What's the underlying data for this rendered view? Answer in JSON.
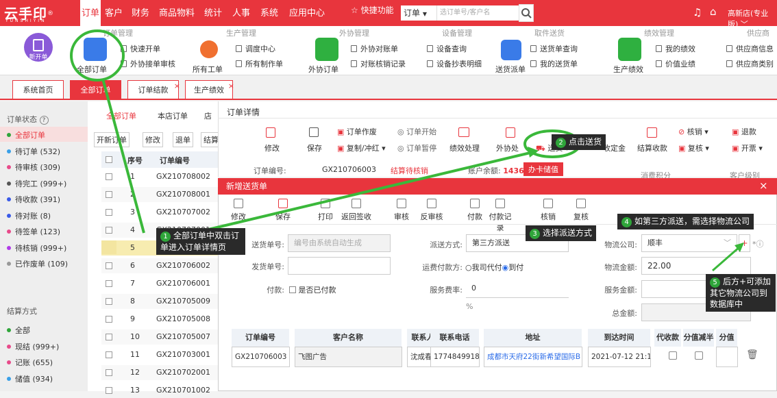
{
  "app": {
    "logo": "云手印",
    "logo_sub": "YUNSHIYIN",
    "logo_badge": "®"
  },
  "nav": {
    "items": [
      "订单",
      "客户",
      "财务",
      "商品物料",
      "统计",
      "人事",
      "系统",
      "应用中心"
    ],
    "quick": "快捷功能",
    "order_select": "订单",
    "search_placeholder": "选订单号/客户名",
    "shop": "高新店(专业版)"
  },
  "ribbon": {
    "groups": [
      "订单管理",
      "生产管理",
      "外协管理",
      "设备管理",
      "取件送货",
      "绩效管理",
      "供应商"
    ],
    "new_order": "新开单",
    "all_orders": "全部订单",
    "quick_order": "快速开单",
    "outsource_review": "外协接单审核",
    "all_work": "所有工单",
    "schedule": "调度中心",
    "all_production": "所有制作单",
    "outsource_order": "外协订单",
    "outsource_reconcile": "外协对账单",
    "reconcile_record": "对账核销记录",
    "device_query": "设备查询",
    "device_meter": "设备抄表明细",
    "dispatch": "送货派单",
    "delivery_query": "送货单查询",
    "my_delivery": "我的送货单",
    "perf": "生产绩效",
    "my_perf": "我的绩效",
    "value_perf": "价值业绩",
    "supplier_info": "供应商信息",
    "supplier_cat": "供应商类别"
  },
  "tabs": [
    "系统首页",
    "全部订单",
    "订单结款",
    "生产绩效"
  ],
  "left": {
    "title": "订单状态",
    "statuses": [
      {
        "label": "全部订单",
        "color": "#2fa53a"
      },
      {
        "label": "待订单 (532)",
        "color": "#3aa0e8"
      },
      {
        "label": "待审核 (309)",
        "color": "#e84a8a"
      },
      {
        "label": "待完工 (999+)",
        "color": "#555"
      },
      {
        "label": "待收款 (391)",
        "color": "#3a5ae8"
      },
      {
        "label": "待对账 (8)",
        "color": "#3a5ae8"
      },
      {
        "label": "待签单 (123)",
        "color": "#e84a8a"
      },
      {
        "label": "待核销 (999+)",
        "color": "#b03ae8"
      },
      {
        "label": "已作废单 (109)",
        "color": "#999"
      }
    ],
    "settle_title": "结算方式",
    "settles": [
      {
        "label": "全部",
        "color": "#2fa53a"
      },
      {
        "label": "现结 (999+)",
        "color": "#e84a8a"
      },
      {
        "label": "记账 (655)",
        "color": "#e84a8a"
      },
      {
        "label": "储值 (934)",
        "color": "#3aa0e8"
      }
    ]
  },
  "list": {
    "tabs": [
      "全部订单",
      "本店订单",
      "店"
    ],
    "buttons": [
      "开新订单",
      "修改",
      "退单",
      "结算"
    ],
    "headers": [
      "序号",
      "订单编号"
    ],
    "rows": [
      [
        "1",
        "GX210708002"
      ],
      [
        "2",
        "GX210708001"
      ],
      [
        "3",
        "GX210707002"
      ],
      [
        "4",
        "GX210707001"
      ],
      [
        "5",
        "GX21"
      ],
      [
        "6",
        "GX210706002"
      ],
      [
        "7",
        "GX210706001"
      ],
      [
        "8",
        "GX210705009"
      ],
      [
        "9",
        "GX210705008"
      ],
      [
        "10",
        "GX210705007"
      ],
      [
        "11",
        "GX210703001"
      ],
      [
        "12",
        "GX210702001"
      ],
      [
        "13",
        "GX210701002"
      ]
    ]
  },
  "detail": {
    "title": "订单详情",
    "btn_edit": "修改",
    "btn_save": "保存",
    "btn_create": "订单作废",
    "btn_copy": "复制/冲红",
    "btn_start": "订单开始",
    "btn_pause": "订单暂停",
    "btn_perf": "绩效处理",
    "btn_out": "外协处",
    "btn_deliver": "送货",
    "btn_settle_amt": "收定金",
    "btn_settle": "结算收款",
    "btn_verify": "核销",
    "btn_review": "复核",
    "btn_refund": "退款",
    "btn_invoice": "开票",
    "order_no_label": "订单编号:",
    "order_no": "GX210706003",
    "order_status": "结算待核销",
    "balance_label": "账户余额:",
    "balance": "1436",
    "card_btn": "办卡储值",
    "points_label": "消费积分",
    "level_label": "客户级别"
  },
  "dialog": {
    "title": "新增送货单",
    "close": "×",
    "toolbar": [
      "修改",
      "保存",
      "打印",
      "返回签收",
      "审核",
      "反审核",
      "付款",
      "付款记录",
      "核销",
      "复核"
    ],
    "delivery_no_label": "送货单号:",
    "delivery_no_ph": "编号由系统自动生成",
    "ship_no_label": "发货单号:",
    "pay_label": "付款:",
    "paid_opt": "是否已付款",
    "method_label": "派送方式:",
    "method": "第三方派送",
    "freight_label": "运费付款方:",
    "opt_pay_by_us": "我司代付",
    "opt_cod": "到付",
    "fee_rate_label": "服务费率:",
    "fee_rate": "0",
    "percent": "%",
    "company_label": "物流公司:",
    "company": "顺丰",
    "add_btn": "+",
    "freight_amt_label": "物流金额:",
    "freight_amt": "22.00",
    "service_amt_label": "服务金额:",
    "total_label": "总金额:"
  },
  "grid": {
    "headers": [
      "订单编号",
      "客户名称",
      "联系人",
      "联系电话",
      "地址",
      "到达时间",
      "代收款",
      "分值减半",
      "分值"
    ],
    "row": {
      "order_no": "GX210706003",
      "customer": "飞图广告",
      "contact": "沈成春",
      "phone": "1774849918",
      "address": "成都市天府22街新希望国际B",
      "arrival": "2021-07-12 21:1"
    }
  },
  "annotations": {
    "a1_num": "1",
    "a1": "全部订单中双击订单进入订单详情页",
    "a2_num": "2",
    "a2": "点击送货",
    "a3_num": "3",
    "a3": "选择派送方式",
    "a4_num": "4",
    "a4": "如第三方派送，需选择物流公司",
    "a5_num": "5",
    "a5": "后方+可添加其它物流公司到数据库中"
  }
}
